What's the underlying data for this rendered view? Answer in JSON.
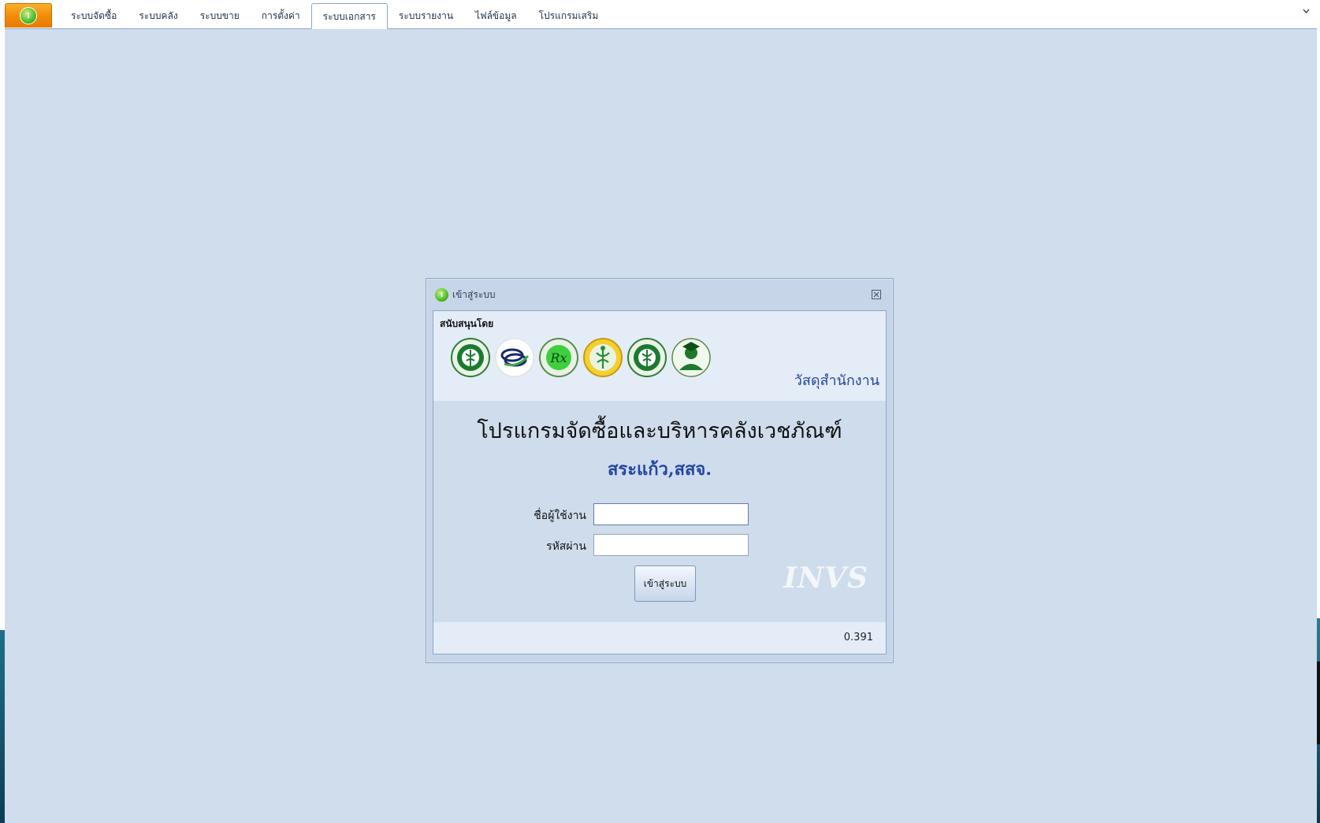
{
  "menu": {
    "app_logo_text": "I",
    "tabs": [
      {
        "label": "ระบบจัดซื้อ",
        "active": false
      },
      {
        "label": "ระบบคลัง",
        "active": false
      },
      {
        "label": "ระบบขาย",
        "active": false
      },
      {
        "label": "การตั้งค่า",
        "active": false
      },
      {
        "label": "ระบบเอกสาร",
        "active": true
      },
      {
        "label": "ระบบรายงาน",
        "active": false
      },
      {
        "label": "ไฟล์ข้อมูล",
        "active": false
      },
      {
        "label": "โปรแกรมเสริม",
        "active": false
      }
    ],
    "collapse_icon": "chevron-down-icon"
  },
  "login_dialog": {
    "title": "เข้าสู่ระบบ",
    "close_icon": "close-icon",
    "sponsor_label": "สนับสนุนโดย",
    "sponsor_logos": [
      "ministry-of-public-health-seal-icon",
      "pharmacy-council-emblem-icon",
      "rx-pharmacy-emblem-icon",
      "provincial-health-office-emblem-icon",
      "hospital-seal-icon",
      "graduate-person-emblem-icon"
    ],
    "department": "วัสดุสำนักงาน",
    "program_title": "โปรแกรมจัดซื้อและบริหารคลังเวชภัณฑ์",
    "organization": "สระแก้ว,สสจ.",
    "username_label": "ชื่อผู้ใช้งาน",
    "username_value": "",
    "password_label": "รหัสผ่าน",
    "password_value": "",
    "login_button": "เข้าสู่ระบบ",
    "watermark": "INVS",
    "version": "0.391"
  },
  "colors": {
    "workspace": "#d0ddec",
    "accent_blue": "#2446a0",
    "app_button_orange": "#f08a08"
  }
}
